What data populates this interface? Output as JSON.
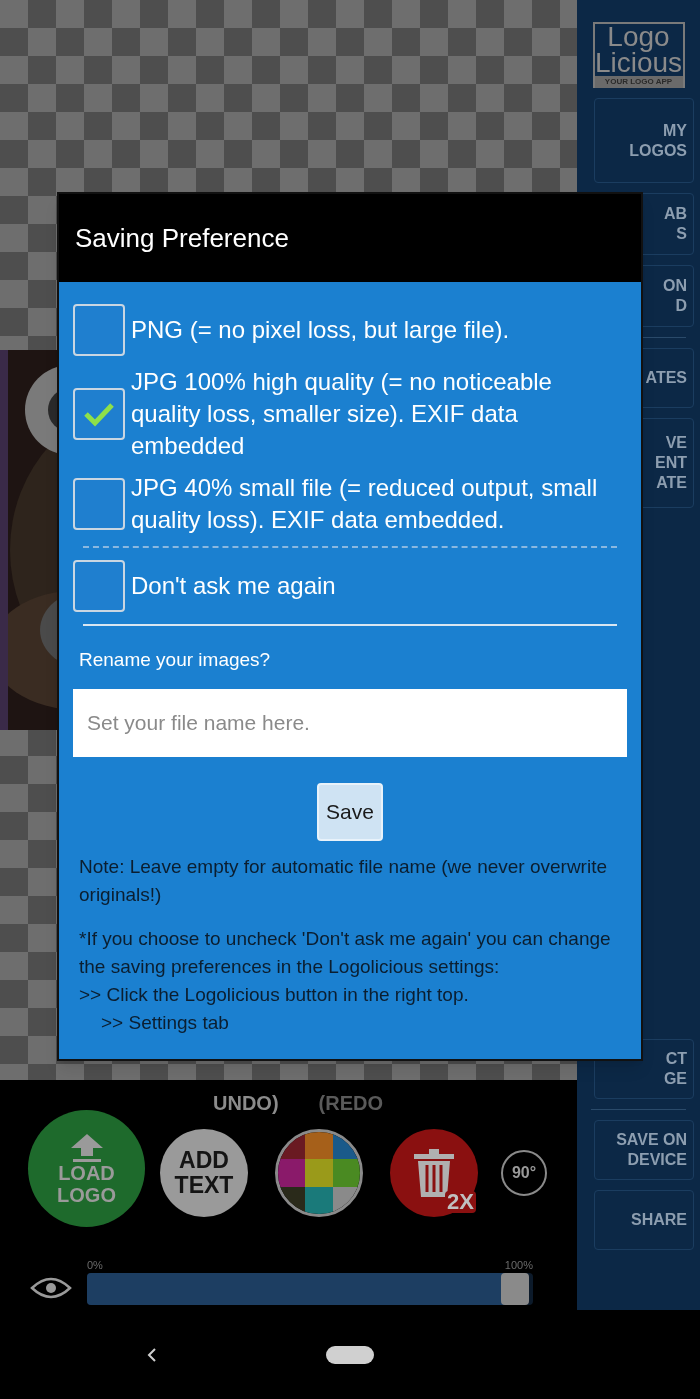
{
  "sidebar": {
    "logo": {
      "line1": "Logo",
      "line2": "Licious",
      "tagline": "YOUR LOGO APP"
    },
    "top_buttons": [
      {
        "lines": [
          "MY",
          "LOGOS"
        ]
      },
      {
        "lines": [
          "AB",
          "S"
        ]
      },
      {
        "lines": [
          "ON",
          "D"
        ]
      }
    ],
    "middle_buttons": [
      {
        "lines": [
          "ATES"
        ]
      },
      {
        "lines": [
          "VE",
          "ENT",
          "ATE"
        ]
      }
    ],
    "bottom_buttons": [
      {
        "lines": [
          "CT",
          "GE"
        ]
      },
      {
        "lines": [
          "SAVE ON",
          "DEVICE"
        ]
      },
      {
        "lines": [
          "SHARE"
        ]
      }
    ]
  },
  "dialog": {
    "title": "Saving Preference",
    "options": [
      {
        "label": "PNG (= no pixel loss, but large file).",
        "checked": false
      },
      {
        "label": "JPG 100% high quality (= no noticeable quality loss, smaller size). EXIF data embedded",
        "checked": true
      },
      {
        "label": "JPG 40% small file (= reduced output, small quality loss). EXIF data embedded.",
        "checked": false
      }
    ],
    "dont_ask": {
      "label": "Don't ask me again",
      "checked": false
    },
    "rename_label": "Rename your images?",
    "filename_field": {
      "placeholder": "Set your file name here."
    },
    "save_button": "Save",
    "note": "Note: Leave empty for automatic file name (we never overwrite originals!)",
    "info_lines": [
      "*If you choose to uncheck 'Don't ask me again' you can change the saving preferences in the Logolicious settings:",
      ">> Click the Logolicious button in the right top.",
      ">> Settings tab"
    ]
  },
  "toolbar": {
    "undo": "UNDO)",
    "redo": "(REDO",
    "load_logo": [
      "LOAD",
      "LOGO"
    ],
    "add_text": [
      "ADD",
      "TEXT"
    ],
    "delete_badge": "2X",
    "rotate": "90°"
  },
  "opacity_slider": {
    "min_label": "0%",
    "max_label": "100%",
    "level": 0.96
  }
}
